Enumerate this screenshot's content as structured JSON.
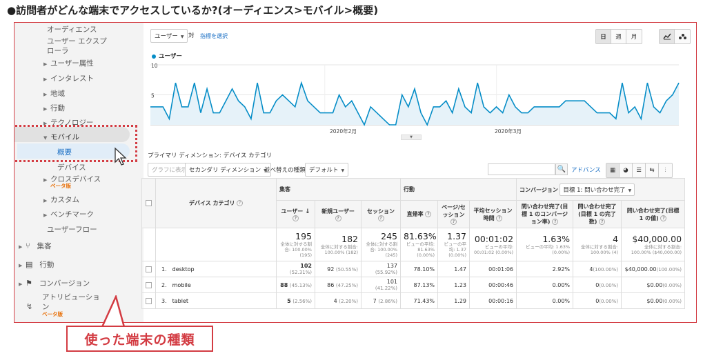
{
  "page_heading": "●訪問者がどんな端末でアクセスしているか?(オーディエンス>モバイル>概要)",
  "callout_text": "使った端末の種類",
  "sidebar": {
    "items": [
      {
        "label": "オーディエンス",
        "top": 0
      },
      {
        "label": "ユーザー エクスプ",
        "top": 0
      },
      {
        "label": "ローラ",
        "top": 0
      },
      {
        "label": "ユーザー属性"
      },
      {
        "label": "インタレスト"
      },
      {
        "label": "地域"
      },
      {
        "label": "行動"
      },
      {
        "label": "テクノロジー"
      },
      {
        "label": "モバイル"
      },
      {
        "label": "概要"
      },
      {
        "label": "デバイス"
      },
      {
        "label": "クロスデバイス"
      },
      {
        "label": "カスタム"
      },
      {
        "label": "ベンチマーク"
      },
      {
        "label": "ユーザーフロー"
      },
      {
        "label": "集客"
      },
      {
        "label": "行動"
      },
      {
        "label": "コンバージョン"
      },
      {
        "label": "アトリビューショ"
      },
      {
        "label": "ン"
      }
    ],
    "beta_label": "ベータ版"
  },
  "toolbar": {
    "metric_select": "ユーザー",
    "vs_label": "対",
    "select_metric_link": "指標を選択",
    "period_buttons": [
      "日",
      "週",
      "月"
    ]
  },
  "chart_data": {
    "type": "line",
    "series": [
      {
        "name": "ユーザー",
        "values": [
          3,
          3,
          3,
          1,
          7,
          3,
          3,
          7,
          2,
          6,
          2,
          2,
          4,
          6,
          4,
          3,
          1,
          7,
          2,
          2,
          4,
          5,
          4,
          3,
          7,
          4,
          3,
          2,
          2,
          2,
          5,
          3,
          4,
          2,
          0,
          3,
          2,
          1,
          0,
          0,
          5,
          3,
          6,
          2,
          0,
          3,
          3,
          4,
          2,
          6,
          3,
          2,
          7,
          3,
          2,
          3,
          2,
          5,
          3,
          2,
          2,
          3,
          3,
          3,
          3,
          3,
          4,
          4,
          4,
          4,
          3,
          2,
          2,
          2,
          1,
          7,
          2,
          3,
          1,
          7,
          3,
          2,
          4,
          5,
          7
        ]
      }
    ],
    "x_tick_labels": [
      "2020年2月",
      "2020年3月"
    ],
    "y_tick_labels": [
      "10",
      "5"
    ],
    "ylim": [
      0,
      10
    ],
    "grid": true,
    "legend": "top-left",
    "color": "#058dc7"
  },
  "primary_dim": {
    "label": "プライマリ ディメンション:",
    "value": "デバイス カテゴリ"
  },
  "table_toolbar": {
    "graph_button": "グラフに表示",
    "secondary_dim": "セカンダリ ディメンション",
    "sort_label": "並べ替えの種類:",
    "sort_value": "デフォルト",
    "advanced_link": "アドバンス"
  },
  "table": {
    "col_device": "デバイス カテゴリ",
    "group_acq": "集客",
    "group_beh": "行動",
    "group_conv": "コンバージョン",
    "goal_select": "目標 1: 問い合わせ完了",
    "headers": [
      "ユーザー",
      "新規ユーザー",
      "セッション",
      "直帰率",
      "ページ/セッション",
      "平均セッション時間",
      "問い合わせ完了(目標 1 のコンバージョン率)",
      "問い合わせ完了(目標 1 の完了数)",
      "問い合わせ完了(目標 1 の値)"
    ],
    "totals": [
      {
        "value": "195",
        "sub": "全体に対する割合: 100.00% (195)"
      },
      {
        "value": "182",
        "sub": "全体に対する割合: 100.00% (182)"
      },
      {
        "value": "245",
        "sub": "全体に対する割合: 100.00% (245)"
      },
      {
        "value": "81.63%",
        "sub": "ビューの平均: 81.63% (0.00%)"
      },
      {
        "value": "1.37",
        "sub": "ビューの平均: 1.37 (0.00%)"
      },
      {
        "value": "00:01:02",
        "sub": "ビューの平均: 00:01:02 (0.00%)"
      },
      {
        "value": "1.63%",
        "sub": "ビューの平均: 1.63% (0.00%)"
      },
      {
        "value": "4",
        "sub": "全体に対する割合: 100.00% (4)"
      },
      {
        "value": "$40,000.00",
        "sub": "全体に対する割合: 100.00% ($40,000.00)"
      }
    ],
    "rows": [
      {
        "idx": "1.",
        "name": "desktop",
        "users": "102",
        "users_pct": "(52.31%)",
        "new": "92",
        "new_pct": "(50.55%)",
        "sess": "137",
        "sess_pct": "(55.92%)",
        "bounce": "78.10%",
        "pps": "1.47",
        "dur": "00:01:06",
        "cr": "2.92%",
        "comp": "4",
        "comp_pct": "(100.00%)",
        "val": "$40,000.00",
        "val_pct": "(100.00%)"
      },
      {
        "idx": "2.",
        "name": "mobile",
        "users": "88",
        "users_pct": "(45.13%)",
        "new": "86",
        "new_pct": "(47.25%)",
        "sess": "101",
        "sess_pct": "(41.22%)",
        "bounce": "87.13%",
        "pps": "1.23",
        "dur": "00:00:46",
        "cr": "0.00%",
        "comp": "0",
        "comp_pct": "(0.00%)",
        "val": "$0.00",
        "val_pct": "(0.00%)"
      },
      {
        "idx": "3.",
        "name": "tablet",
        "users": "5",
        "users_pct": "(2.56%)",
        "new": "4",
        "new_pct": "(2.20%)",
        "sess": "7",
        "sess_pct": "(2.86%)",
        "bounce": "71.43%",
        "pps": "1.29",
        "dur": "00:00:16",
        "cr": "0.00%",
        "comp": "0",
        "comp_pct": "(0.00%)",
        "val": "$0.00",
        "val_pct": "(0.00%)"
      }
    ]
  },
  "colors": {
    "accent": "#d33b42",
    "series": "#058dc7",
    "link": "#1a6fc4"
  }
}
